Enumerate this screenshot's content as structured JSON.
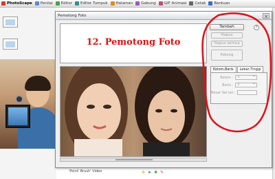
{
  "app": {
    "tabs": [
      {
        "label": "PhotoScape",
        "icon": "photoscape-icon",
        "color": "#d43b2f"
      },
      {
        "label": "Penilai",
        "icon": "viewer-icon",
        "color": "#5b8bd1"
      },
      {
        "label": "Editor",
        "icon": "editor-icon",
        "color": "#4aa04a"
      },
      {
        "label": "Editor Tumpuk",
        "icon": "batch-editor-icon",
        "color": "#2f8f8f"
      },
      {
        "label": "Halaman",
        "icon": "page-icon",
        "color": "#e08a22"
      },
      {
        "label": "Gabung",
        "icon": "combine-icon",
        "color": "#9b59b6"
      },
      {
        "label": "GIF Animasi",
        "icon": "gif-icon",
        "color": "#c44c7a"
      },
      {
        "label": "Cetak",
        "icon": "print-icon",
        "color": "#666666"
      },
      {
        "label": "Bantuan",
        "icon": "help-icon",
        "color": "#3b6fbf"
      }
    ],
    "bottom_caption": "'Point' Brush' Video"
  },
  "dialog": {
    "title": "Pemotong Foto",
    "banner_title": "12. Pemotong Foto",
    "buttons": {
      "add": "Tambah",
      "delete": "Hapus",
      "delete_all": "Hapus semua",
      "crop": "Potong"
    },
    "tabs": [
      "Kolom,Baris",
      "Lebar,Tinggi"
    ],
    "fields": {
      "columns_label": "Kolom :",
      "columns_value": "3",
      "rows_label": "Baris :",
      "rows_value": "3",
      "border_label": "Besar Sel lan :"
    }
  },
  "annotation": {
    "color": "#e0121b"
  },
  "colors": {
    "accent": "#e01010"
  }
}
